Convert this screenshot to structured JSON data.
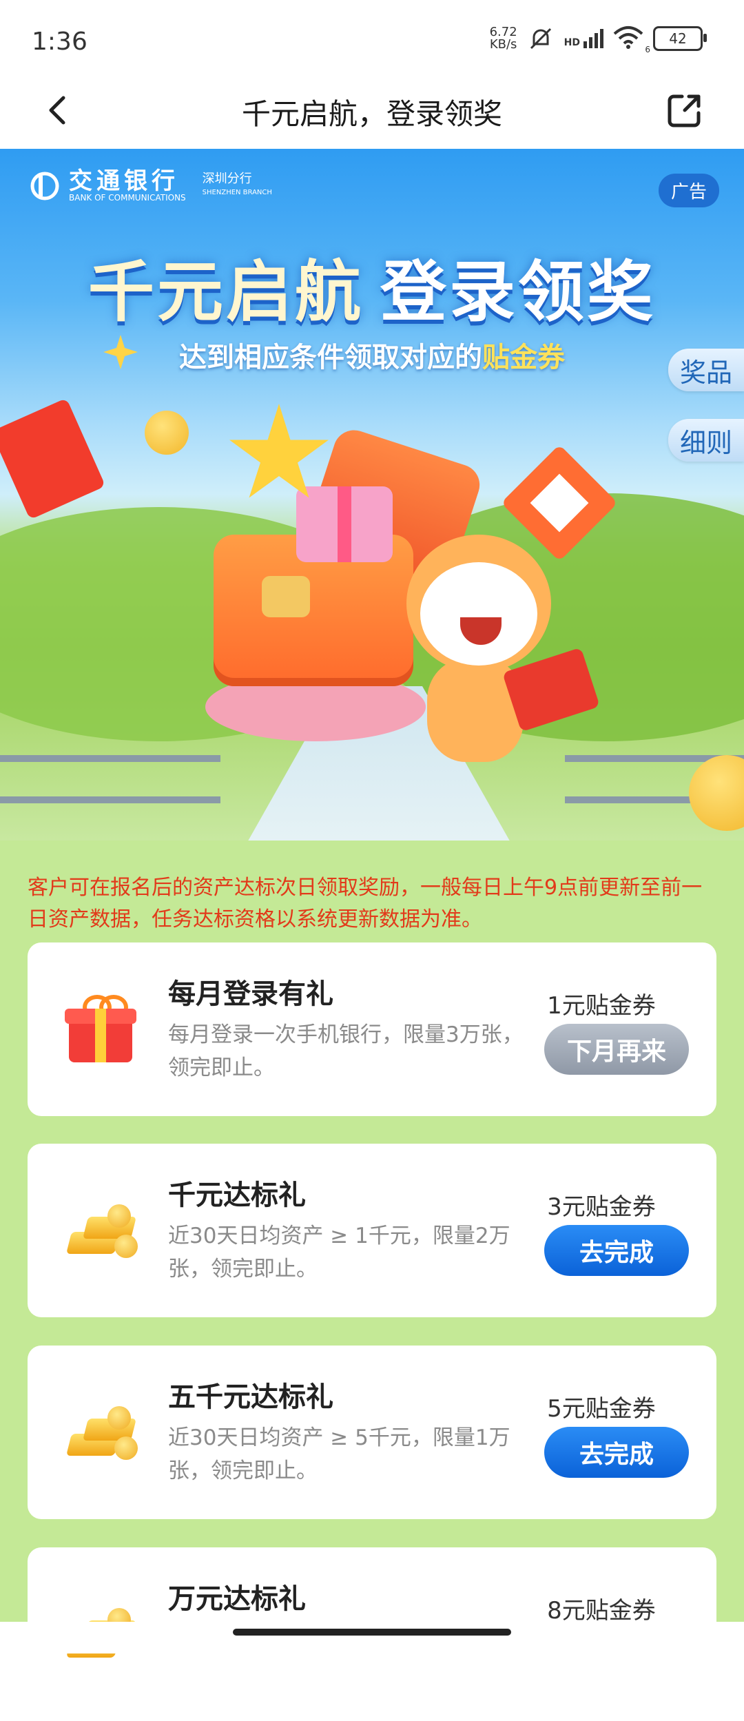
{
  "status_bar": {
    "time": "1:36",
    "net_speed_value": "6.72",
    "net_speed_unit": "KB/s",
    "network_label": "HD",
    "wifi_label": "6",
    "battery": "42"
  },
  "nav": {
    "title": "千元启航，登录领奖"
  },
  "hero": {
    "bank_name_cn": "交通银行",
    "bank_name_en": "BANK OF COMMUNICATIONS",
    "branch_cn": "深圳分行",
    "branch_en": "SHENZHEN BRANCH",
    "ad_label": "广告",
    "title_part1": "千元启航",
    "title_part2": "登录领奖",
    "subtitle_main": "达到相应条件领取对应的",
    "subtitle_highlight": "贴金券",
    "tab_prize": "奖品",
    "tab_rules": "细则"
  },
  "notice": "客户可在报名后的资产达标次日领取奖励，一般每日上午9点前更新至前一日资产数据，任务达标资格以系统更新数据为准。",
  "tasks": [
    {
      "title": "每月登录有礼",
      "desc": "每月登录一次手机银行，限量3万张，领完即止。",
      "reward": "1元贴金券",
      "button": "下月再来",
      "icon": "gift-icon"
    },
    {
      "title": "千元达标礼",
      "desc": "近30天日均资产 ≥ 1千元，限量2万张，领完即止。",
      "reward": "3元贴金券",
      "button": "去完成",
      "icon": "gold-bars-icon"
    },
    {
      "title": "五千元达标礼",
      "desc": "近30天日均资产 ≥ 5千元，限量1万张，领完即止。",
      "reward": "5元贴金券",
      "button": "去完成",
      "icon": "gold-bars-icon"
    },
    {
      "title": "万元达标礼",
      "reward": "8元贴金券",
      "icon": "gold-bars-icon"
    }
  ],
  "colors": {
    "notice_text": "#e23a1a",
    "primary_button": "#1a73e8",
    "disabled_button": "#9aa2ae",
    "content_bg": "#c4e996"
  }
}
